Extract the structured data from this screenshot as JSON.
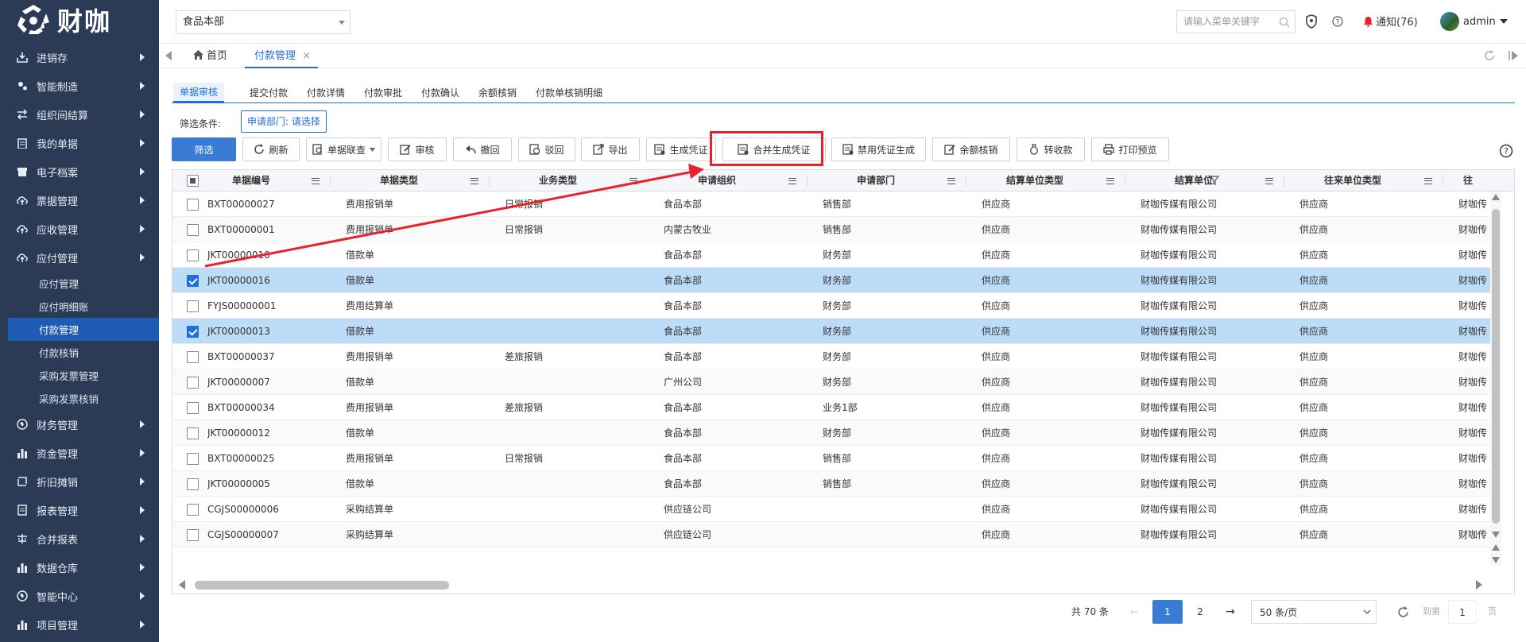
{
  "brand": {
    "logo_text": "财咖",
    "logo_sub": "咖"
  },
  "sidebar": {
    "items": [
      {
        "label": "进销存",
        "icon": "download-tray-icon"
      },
      {
        "label": "智能制造",
        "icon": "gears-icon"
      },
      {
        "label": "组织间结算",
        "icon": "exchange-icon"
      },
      {
        "label": "我的单据",
        "icon": "clipboard-icon"
      },
      {
        "label": "电子档案",
        "icon": "archive-icon"
      },
      {
        "label": "票据管理",
        "icon": "cloud-upload-icon"
      },
      {
        "label": "应收管理",
        "icon": "cloud-upload-icon"
      },
      {
        "label": "应付管理",
        "icon": "cloud-upload-icon"
      }
    ],
    "subitems": [
      "应付管理",
      "应付明细账",
      "付款管理",
      "付款核销",
      "采购发票管理",
      "采购发票核销"
    ],
    "active_subitem": "付款管理",
    "items2": [
      {
        "label": "财务管理",
        "icon": "globe-icon"
      },
      {
        "label": "资金管理",
        "icon": "bar-chart-icon"
      },
      {
        "label": "折旧摊销",
        "icon": "recycle-icon"
      },
      {
        "label": "报表管理",
        "icon": "report-icon"
      },
      {
        "label": "合并报表",
        "icon": "merge-icon"
      },
      {
        "label": "数据仓库",
        "icon": "bar-chart-icon"
      },
      {
        "label": "智能中心",
        "icon": "globe-icon"
      },
      {
        "label": "项目管理",
        "icon": "bar-chart-icon"
      }
    ]
  },
  "topbar": {
    "company": "食品本部",
    "search_placeholder": "请输入菜单关键字",
    "notify_label": "通知(76)",
    "user": "admin"
  },
  "tabs": {
    "home": "首页",
    "current": "付款管理",
    "close": "×"
  },
  "subtabs": [
    "单据审核",
    "提交付款",
    "付款详情",
    "付款审批",
    "付款确认",
    "余额核销",
    "付款单核销明细"
  ],
  "filter": {
    "label": "筛选条件:",
    "tag": "申请部门: 请选择"
  },
  "toolbar": [
    {
      "label": "筛选",
      "icon": ""
    },
    {
      "label": "刷新",
      "icon": "refresh-icon"
    },
    {
      "label": "单据联查",
      "icon": "search-doc-icon"
    },
    {
      "label": "审核",
      "icon": "edit-icon"
    },
    {
      "label": "撤回",
      "icon": "undo-icon"
    },
    {
      "label": "驳回",
      "icon": "reject-icon"
    },
    {
      "label": "导出",
      "icon": "export-icon"
    },
    {
      "label": "生成凭证",
      "icon": "voucher-icon"
    },
    {
      "label": "合并生成凭证",
      "icon": "voucher-icon"
    },
    {
      "label": "禁用凭证生成",
      "icon": "voucher-icon"
    },
    {
      "label": "余额核销",
      "icon": "edit-icon"
    },
    {
      "label": "转收款",
      "icon": "money-bag-icon"
    },
    {
      "label": "打印预览",
      "icon": "printer-icon"
    }
  ],
  "columns": [
    "单据编号",
    "单据类型",
    "业务类型",
    "申请组织",
    "申请部门",
    "结算单位类型",
    "结算单位",
    "往来单位类型",
    "往"
  ],
  "rows": [
    {
      "checked": false,
      "cells": [
        "BXT00000027",
        "费用报销单",
        "日常报销",
        "食品本部",
        "销售部",
        "供应商",
        "财咖传媒有限公司",
        "供应商",
        "财咖传"
      ]
    },
    {
      "checked": false,
      "cells": [
        "BXT00000001",
        "费用报销单",
        "日常报销",
        "内蒙古牧业",
        "销售部",
        "供应商",
        "财咖传媒有限公司",
        "供应商",
        "财咖传"
      ]
    },
    {
      "checked": false,
      "cells": [
        "JKT00000010",
        "借款单",
        "",
        "食品本部",
        "财务部",
        "供应商",
        "财咖传媒有限公司",
        "供应商",
        "财咖传"
      ]
    },
    {
      "checked": true,
      "cells": [
        "JKT00000016",
        "借款单",
        "",
        "食品本部",
        "财务部",
        "供应商",
        "财咖传媒有限公司",
        "供应商",
        "财咖传"
      ]
    },
    {
      "checked": false,
      "cells": [
        "FYJS00000001",
        "费用结算单",
        "",
        "食品本部",
        "财务部",
        "供应商",
        "财咖传媒有限公司",
        "供应商",
        "财咖传"
      ]
    },
    {
      "checked": true,
      "cells": [
        "JKT00000013",
        "借款单",
        "",
        "食品本部",
        "财务部",
        "供应商",
        "财咖传媒有限公司",
        "供应商",
        "财咖传"
      ]
    },
    {
      "checked": false,
      "cells": [
        "BXT00000037",
        "费用报销单",
        "差旅报销",
        "食品本部",
        "财务部",
        "供应商",
        "财咖传媒有限公司",
        "供应商",
        "财咖传"
      ]
    },
    {
      "checked": false,
      "cells": [
        "JKT00000007",
        "借款单",
        "",
        "广州公司",
        "财务部",
        "供应商",
        "财咖传媒有限公司",
        "供应商",
        "财咖传"
      ]
    },
    {
      "checked": false,
      "cells": [
        "BXT00000034",
        "费用报销单",
        "差旅报销",
        "食品本部",
        "业务1部",
        "供应商",
        "财咖传媒有限公司",
        "供应商",
        "财咖传"
      ]
    },
    {
      "checked": false,
      "cells": [
        "JKT00000012",
        "借款单",
        "",
        "食品本部",
        "财务部",
        "供应商",
        "财咖传媒有限公司",
        "供应商",
        "财咖传"
      ]
    },
    {
      "checked": false,
      "cells": [
        "BXT00000025",
        "费用报销单",
        "日常报销",
        "食品本部",
        "销售部",
        "供应商",
        "财咖传媒有限公司",
        "供应商",
        "财咖传"
      ]
    },
    {
      "checked": false,
      "cells": [
        "JKT00000005",
        "借款单",
        "",
        "食品本部",
        "销售部",
        "供应商",
        "财咖传媒有限公司",
        "供应商",
        "财咖传"
      ]
    },
    {
      "checked": false,
      "cells": [
        "CGJS00000006",
        "采购结算单",
        "",
        "供应链公司",
        "",
        "供应商",
        "财咖传媒有限公司",
        "供应商",
        "财咖传"
      ]
    },
    {
      "checked": false,
      "cells": [
        "CGJS00000007",
        "采购结算单",
        "",
        "供应链公司",
        "",
        "供应商",
        "财咖传媒有限公司",
        "供应商",
        "财咖传"
      ]
    }
  ],
  "pager": {
    "total": "共 70 条",
    "pages": [
      "1",
      "2"
    ],
    "current": "1",
    "page_size": "50 条/页",
    "goto_label": "到第",
    "goto_value": "1",
    "page_unit": "页",
    "prev": "←",
    "next": "→"
  },
  "colors": {
    "sidebar_bg": "#2b3a55",
    "accent": "#1e6fd9",
    "selected_row": "#bcdcf8",
    "annotation_red": "#e8222a"
  }
}
